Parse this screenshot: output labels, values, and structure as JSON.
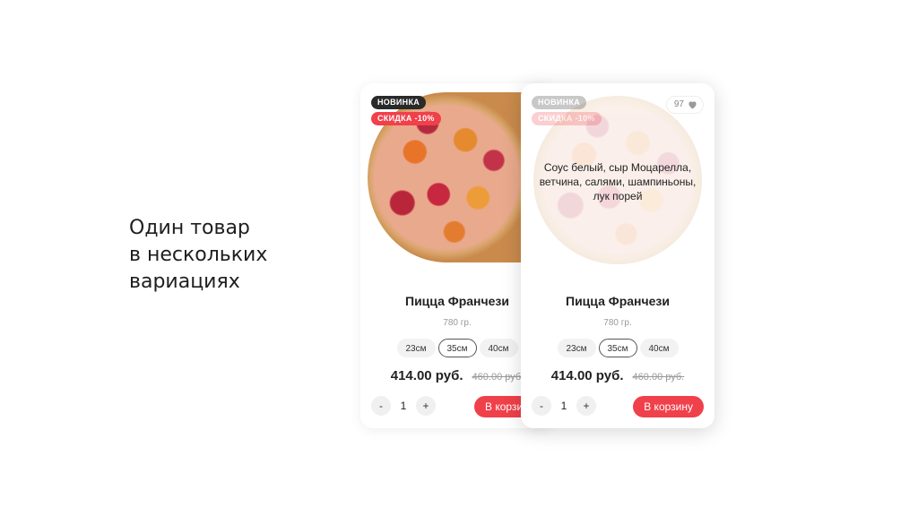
{
  "headline": {
    "line1": "Один товар",
    "line2": "в нескольких",
    "line3": "вариациях"
  },
  "product": {
    "badge_new": "НОВИНКА",
    "badge_sale": "СКИДКА -10%",
    "likes": "97",
    "description": "Соус белый, сыр Моцарелла, ветчина, салями, шампиньоны, лук порей",
    "title": "Пицца Франчези",
    "weight": "780 гр.",
    "sizes": [
      "23см",
      "35см",
      "40см"
    ],
    "selected_size": "35см",
    "price": "414.00 руб.",
    "old_price": "460.00 руб.",
    "minus": "-",
    "quantity": "1",
    "plus": "+",
    "cart_button": "В корзину",
    "cart_button_truncated": "В корзи"
  },
  "colors": {
    "accent": "#f0404a",
    "badge_dark": "#2a2a2a"
  },
  "icons": {
    "likes": "heart-icon"
  }
}
